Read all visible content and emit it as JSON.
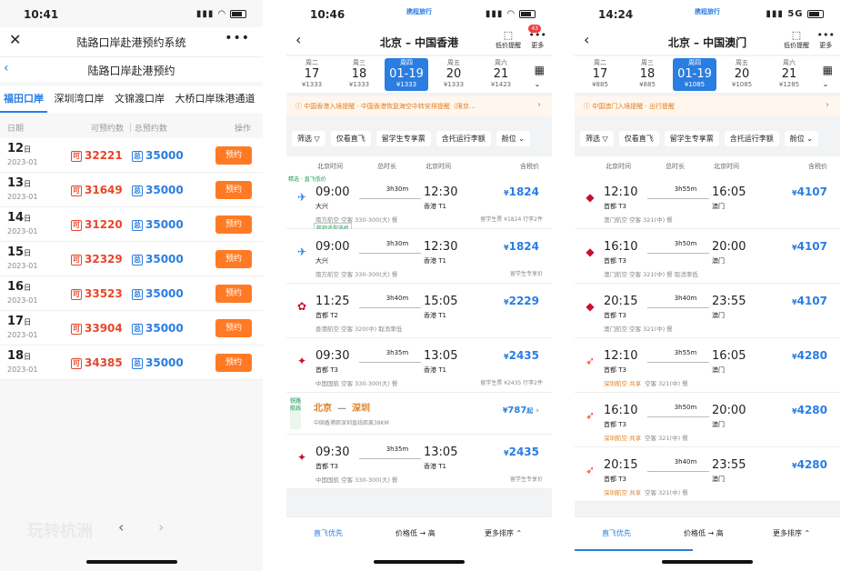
{
  "panel1": {
    "status": {
      "time": "10:41"
    },
    "title": "陆路口岸赴港预约系统",
    "subtitle": "陆路口岸赴港预约",
    "ports": [
      "福田口岸",
      "深圳湾口岸",
      "文锦渡口岸",
      "大桥口岸珠港通道"
    ],
    "headers": {
      "date": "日期",
      "avail_total": "可预约数 ｜总预约数",
      "op": "操作"
    },
    "tag_avail": "可",
    "tag_total": "总",
    "rows": [
      {
        "day": "12",
        "unit": "日",
        "year": "2023-01",
        "avail": "32221",
        "total": "35000",
        "btn": "预约"
      },
      {
        "day": "13",
        "unit": "日",
        "year": "2023-01",
        "avail": "31649",
        "total": "35000",
        "btn": "预约"
      },
      {
        "day": "14",
        "unit": "日",
        "year": "2023-01",
        "avail": "31220",
        "total": "35000",
        "btn": "预约"
      },
      {
        "day": "15",
        "unit": "日",
        "year": "2023-01",
        "avail": "32329",
        "total": "35000",
        "btn": "预约"
      },
      {
        "day": "16",
        "unit": "日",
        "year": "2023-01",
        "avail": "33523",
        "total": "35000",
        "btn": "预约"
      },
      {
        "day": "17",
        "unit": "日",
        "year": "2023-01",
        "avail": "33904",
        "total": "35000",
        "btn": "预约"
      },
      {
        "day": "18",
        "unit": "日",
        "year": "2023-01",
        "avail": "34385",
        "total": "35000",
        "btn": "预约"
      }
    ],
    "watermark": "玩转杭洲"
  },
  "panel2": {
    "status": {
      "time": "10:46"
    },
    "logo": "携程旅行",
    "route": "北京 – 中国香港",
    "trend": "低价提醒",
    "more": "更多",
    "badge": "43",
    "dates": [
      {
        "w": "周二",
        "n": "17",
        "p": "¥1333"
      },
      {
        "w": "周三",
        "n": "18",
        "p": "¥1333"
      },
      {
        "w": "周四",
        "n": "01-19",
        "p": "¥1333"
      },
      {
        "w": "周五",
        "n": "20",
        "p": "¥1333"
      },
      {
        "w": "周六",
        "n": "21",
        "p": "¥1423"
      }
    ],
    "notice": "中国香港入境提醒 · 中国香港恢复海空中转安排提醒（限京…",
    "filters": [
      "筛选 ▽",
      "仅看直飞",
      "留学生专享票",
      "含托运行李额",
      "舱位 ⌄"
    ],
    "cols": {
      "bj_time1": "北京时间",
      "duration": "总时长",
      "bj_time2": "北京时间",
      "tax": "含税价"
    },
    "flights": [
      {
        "pick": "精选 · 直飞低价",
        "dep": "09:00",
        "dap": "大兴",
        "dur": "3h30m",
        "arr": "12:30",
        "aap": "香港 T1",
        "price": "1824",
        "info": "南方航空  空客 330-300(大)  餐",
        "extra": "留学生票 ¥1824 行李2件",
        "rtag": "航舒适型选机",
        "icon": "✈"
      },
      {
        "dep": "09:00",
        "dap": "大兴",
        "dur": "3h30m",
        "arr": "12:30",
        "aap": "香港 T1",
        "price": "1824",
        "info": "南方航空  空客 330-300(大)  餐",
        "extra": "留学生专享价",
        "icon": "✈"
      },
      {
        "dep": "11:25",
        "dap": "首都 T2",
        "dur": "3h40m",
        "arr": "15:05",
        "aap": "香港 T1",
        "price": "2229",
        "info": "香港航空  空客 320(中)  取消率低",
        "extra": "",
        "icon": "✿"
      },
      {
        "dep": "09:30",
        "dap": "首都 T3",
        "dur": "3h35m",
        "arr": "13:05",
        "aap": "香港 T1",
        "price": "2435",
        "info": "中国国航  空客 330-300(大)  餐",
        "extra": "留学生票 ¥2435 行李2件",
        "icon": "✦"
      }
    ],
    "rail": {
      "tag": "铁路航线",
      "from": "北京",
      "to": "深圳",
      "desc": "中国香港距深圳直线距离38KM",
      "price": "787",
      "suffix": "起"
    },
    "flights2": [
      {
        "dep": "09:30",
        "dap": "首都 T3",
        "dur": "3h35m",
        "arr": "13:05",
        "aap": "香港 T1",
        "price": "2435",
        "info": "中国国航  空客 330-300(大)  餐",
        "extra": "留学生专享价",
        "icon": "✦"
      }
    ],
    "bottom": {
      "direct": "直飞优先",
      "price": "价格低 → 高",
      "sort": "更多排序 ⌃"
    }
  },
  "panel3": {
    "status": {
      "time": "14:24"
    },
    "logo": "携程旅行",
    "route": "北京 – 中国澳门",
    "trend": "低价提醒",
    "more": "更多",
    "dates": [
      {
        "w": "周二",
        "n": "17",
        "p": "¥885"
      },
      {
        "w": "周三",
        "n": "18",
        "p": "¥885"
      },
      {
        "w": "周四",
        "n": "01-19",
        "p": "¥1085"
      },
      {
        "w": "周五",
        "n": "20",
        "p": "¥1085"
      },
      {
        "w": "周六",
        "n": "21",
        "p": "¥1285"
      }
    ],
    "notice": "中国澳门入境提醒 · 出行提醒",
    "filters": [
      "筛选 ▽",
      "仅看直飞",
      "留学生专享票",
      "含托运行李额",
      "舱位 ⌄"
    ],
    "cols": {
      "bj_time1": "北京时间",
      "duration": "总时长",
      "bj_time2": "北京时间",
      "tax": "含税价"
    },
    "flights": [
      {
        "dep": "12:10",
        "dap": "首都 T3",
        "dur": "3h55m",
        "arr": "16:05",
        "aap": "澳门",
        "price": "4107",
        "info": "澳门航空  空客 321(中)  餐",
        "share": "",
        "icon": "◆"
      },
      {
        "dep": "16:10",
        "dap": "首都 T3",
        "dur": "3h50m",
        "arr": "20:00",
        "aap": "澳门",
        "price": "4107",
        "info": "澳门航空  空客 321(中)  餐  取消率低",
        "share": "",
        "icon": "◆"
      },
      {
        "dep": "20:15",
        "dap": "首都 T3",
        "dur": "3h40m",
        "arr": "23:55",
        "aap": "澳门",
        "price": "4107",
        "info": "澳门航空  空客 321(中)  餐",
        "share": "",
        "icon": "◆"
      },
      {
        "dep": "12:10",
        "dap": "首都 T3",
        "dur": "3h55m",
        "arr": "16:05",
        "aap": "澳门",
        "price": "4280",
        "info": "空客 321(中)  餐",
        "share": "深圳航空 共享",
        "icon": "➶"
      },
      {
        "dep": "16:10",
        "dap": "首都 T3",
        "dur": "3h50m",
        "arr": "20:00",
        "aap": "澳门",
        "price": "4280",
        "info": "空客 321(中)  餐",
        "share": "深圳航空 共享",
        "icon": "➶"
      },
      {
        "dep": "20:15",
        "dap": "首都 T3",
        "dur": "3h40m",
        "arr": "23:55",
        "aap": "澳门",
        "price": "4280",
        "info": "空客 321(中)  餐",
        "share": "深圳航空 共享",
        "icon": "➶"
      }
    ],
    "bottom": {
      "direct": "直飞优先",
      "price": "价格低 → 高",
      "sort": "更多排序 ⌃"
    }
  }
}
